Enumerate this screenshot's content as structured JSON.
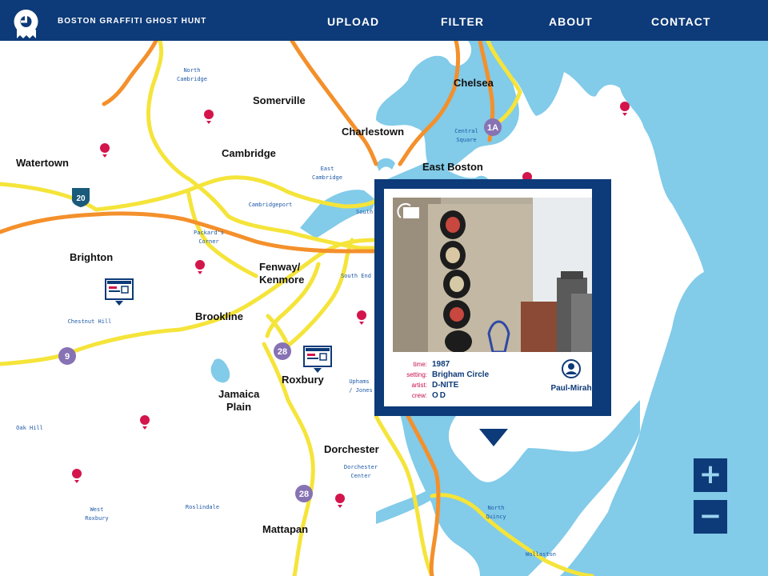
{
  "app": {
    "title": "BOSTON GRAFFITI GHOST HUNT"
  },
  "nav": {
    "items": [
      "UPLOAD",
      "FILTER",
      "ABOUT",
      "CONTACT"
    ]
  },
  "colors": {
    "header": "#0d3a78",
    "water": "#82cbe9",
    "highway_orange": "#f4902b",
    "road_yellow": "#f5e43a",
    "pin": "#d3154c",
    "route_marker": "#8772b4",
    "interstate": "#1a5a7a"
  },
  "map": {
    "neighborhoods": [
      "Chelsea",
      "Somerville",
      "Charlestown",
      "Cambridge",
      "Watertown",
      "East Boston",
      "Brighton",
      "Fenway/",
      "Kenmore",
      "Brookline",
      "Jamaica",
      "Plain",
      "Roxbury",
      "Dorchester",
      "Mattapan"
    ],
    "small_labels": [
      "North",
      "Cambridge",
      "Central",
      "Square",
      "East",
      "Cambridge",
      "Cambridgeport",
      "South",
      "Packard's",
      "Corner",
      "South End",
      "Chestnut Hill",
      "Uphams",
      "/ Jones",
      "Oak Hill",
      "Dorchester",
      "Center",
      "West",
      "Roxbury",
      "Roslindale",
      "North",
      "Quincy",
      "Wollaston"
    ],
    "route_markers": [
      "1A",
      "9",
      "28",
      "28"
    ],
    "interstate_marker": "20",
    "pin_icon": "map-pin-icon",
    "gallery_marker_icon": "photo-gallery-marker-icon"
  },
  "popup": {
    "time_key": "time:",
    "time": "1987",
    "setting_key": "setting:",
    "setting": "Brigham Circle",
    "artist_key": "artist:",
    "artist": "D-NITE",
    "crew_key": "crew:",
    "crew": "OD",
    "user": "Paul-Mirah",
    "user_icon": "user-avatar-icon"
  },
  "zoom": {
    "in_label": "+",
    "out_label": "−"
  }
}
